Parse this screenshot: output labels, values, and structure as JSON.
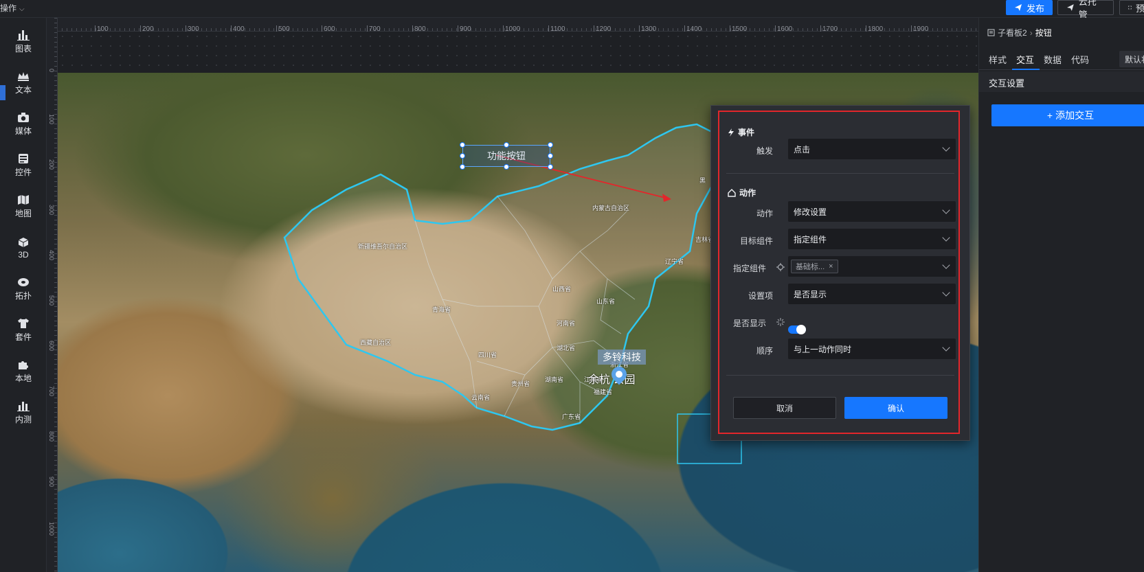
{
  "topbar": {
    "menu_label": "操作",
    "publish_label": "发布",
    "host_label": "云托管",
    "preview_label": "预"
  },
  "leftbar": {
    "items": [
      {
        "label": "图表",
        "icon": "chart-bar-icon"
      },
      {
        "label": "文本",
        "icon": "text-crown-icon"
      },
      {
        "label": "媒体",
        "icon": "media-camera-icon"
      },
      {
        "label": "控件",
        "icon": "widget-icon"
      },
      {
        "label": "地图",
        "icon": "map-icon"
      },
      {
        "label": "3D",
        "icon": "cube-icon"
      },
      {
        "label": "拓扑",
        "icon": "topology-icon"
      },
      {
        "label": "套件",
        "icon": "shirt-icon"
      },
      {
        "label": "本地",
        "icon": "puzzle-icon"
      },
      {
        "label": "内测",
        "icon": "beta-chart-icon"
      }
    ]
  },
  "ruler": {
    "h_labels": [
      "100",
      "200",
      "300",
      "400",
      "500",
      "600",
      "700",
      "800",
      "900",
      "1000",
      "1100",
      "1200",
      "1300",
      "1400",
      "1500",
      "1600",
      "1700",
      "1800",
      "1900"
    ],
    "v_labels": [
      "0",
      "100",
      "200",
      "300",
      "400",
      "500",
      "600",
      "700",
      "800",
      "900",
      "1000"
    ]
  },
  "canvas": {
    "function_button_label": "功能按钮",
    "brand_badge": "多铃科技",
    "park_label": "余杭    公园",
    "provinces": [
      {
        "name": "内蒙古自治区"
      },
      {
        "name": "新疆维吾尔自治区"
      },
      {
        "name": "青海省"
      },
      {
        "name": "西藏自治区"
      },
      {
        "name": "四川省"
      },
      {
        "name": "云南省"
      },
      {
        "name": "贵州省"
      },
      {
        "name": "湖南省"
      },
      {
        "name": "湖北省"
      },
      {
        "name": "河南省"
      },
      {
        "name": "山西省"
      },
      {
        "name": "山东省"
      },
      {
        "name": "辽宁省"
      },
      {
        "name": "吉林省"
      },
      {
        "name": "江西省"
      },
      {
        "name": "福建省"
      },
      {
        "name": "广东省"
      },
      {
        "name": "浙江省"
      },
      {
        "name": "黑"
      }
    ]
  },
  "dialog": {
    "event_title": "事件",
    "trigger_label": "触发",
    "trigger_value": "点击",
    "action_title": "动作",
    "action_label": "动作",
    "action_value": "修改设置",
    "target_label": "目标组件",
    "target_value": "指定组件",
    "specified_label": "指定组件",
    "specified_tag": "基础标...",
    "setting_label": "设置项",
    "setting_value": "是否显示",
    "visible_label": "是否显示",
    "visible_value": true,
    "order_label": "顺序",
    "order_value": "与上一动作同时",
    "cancel_label": "取消",
    "confirm_label": "确认",
    "highlight_color": "#e3262b"
  },
  "rpanel": {
    "breadcrumb_parent": "子看板2",
    "breadcrumb_current": "按钮",
    "tabs": [
      {
        "label": "样式"
      },
      {
        "label": "交互"
      },
      {
        "label": "数据"
      },
      {
        "label": "代码"
      }
    ],
    "active_tab": "交互",
    "default_label": "默认状",
    "section_title": "交互设置",
    "add_label": "添加交互"
  },
  "colors": {
    "accent": "#1677ff",
    "highlight": "#e3262b",
    "border_outline": "#2ec7f0"
  }
}
